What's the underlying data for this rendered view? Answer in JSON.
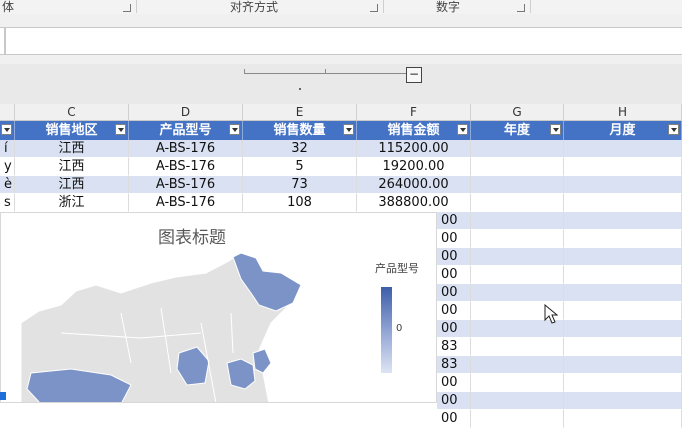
{
  "ribbon": {
    "groups": [
      {
        "label": "体"
      },
      {
        "label": "对齐方式"
      },
      {
        "label": "数字"
      }
    ]
  },
  "zoom": {
    "button": "−"
  },
  "columns": [
    "C",
    "D",
    "E",
    "F",
    "G",
    "H"
  ],
  "table": {
    "headers": [
      "销售地区",
      "产品型号",
      "销售数量",
      "销售金额",
      "年度",
      "月度"
    ],
    "rows": [
      {
        "a": "í",
        "region": "江西",
        "model": "A-BS-176",
        "qty": "32",
        "amount": "115200.00"
      },
      {
        "a": "y",
        "region": "江西",
        "model": "A-BS-176",
        "qty": "5",
        "amount": "19200.00"
      },
      {
        "a": "è",
        "region": "江西",
        "model": "A-BS-176",
        "qty": "73",
        "amount": "264000.00"
      },
      {
        "a": "s ă",
        "region": "浙江",
        "model": "A-BS-176",
        "qty": "108",
        "amount": "388800.00"
      }
    ],
    "partial_amounts": [
      "00",
      "00",
      "00",
      "00",
      "00",
      "00",
      "00",
      "83",
      "83",
      "00",
      "00",
      "00"
    ]
  },
  "chart": {
    "title": "图表标题",
    "legend_title": "产品型号",
    "legend_value": "0",
    "colors": {
      "map_gray": "#e2e2e2",
      "map_blue": "#7c93c8",
      "accent": "#4472c4"
    }
  },
  "chart_data": {
    "type": "map",
    "title": "图表标题",
    "legend": {
      "title": "产品型号",
      "ticks": [
        "0"
      ]
    },
    "highlighted_regions": [
      "黑龙江",
      "江西",
      "浙江",
      "西藏",
      "四川"
    ]
  }
}
